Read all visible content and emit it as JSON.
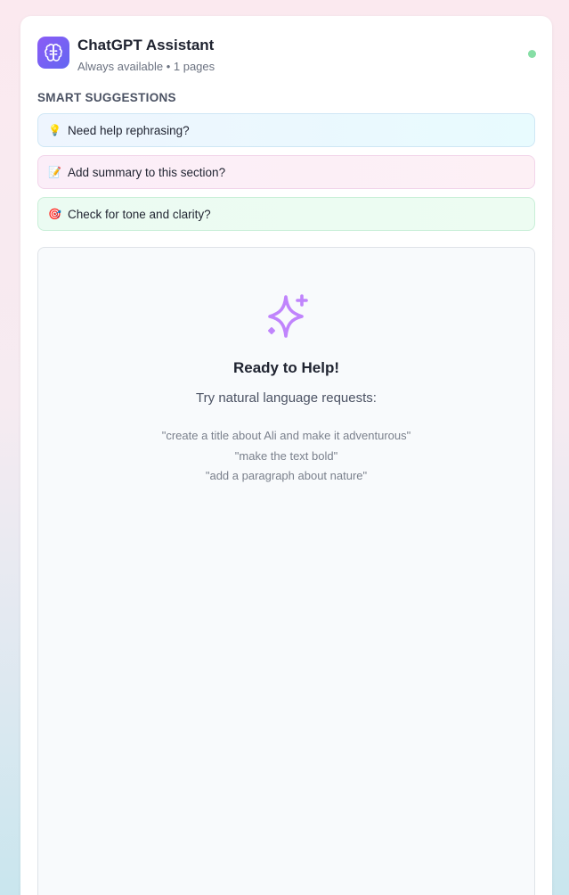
{
  "header": {
    "title": "ChatGPT Assistant",
    "subtitle": "Always available • 1 pages",
    "icon": "brain-icon",
    "status_color": "#86dea5"
  },
  "suggestions": {
    "section_label": "SMART SUGGESTIONS",
    "items": [
      {
        "emoji": "💡",
        "label": "Need help rephrasing?"
      },
      {
        "emoji": "📝",
        "label": "Add summary to this section?"
      },
      {
        "emoji": "🎯",
        "label": "Check for tone and clarity?"
      }
    ]
  },
  "empty_state": {
    "icon": "sparkle-icon",
    "title": "Ready to Help!",
    "subtitle": "Try natural language requests:",
    "examples": [
      "\"create a title about Ali and make it adventurous\"",
      "\"make the text bold\"",
      "\"add a paragraph about nature\""
    ]
  },
  "colors": {
    "accent": "#8b5cf6",
    "sparkle": "#c084fc"
  }
}
